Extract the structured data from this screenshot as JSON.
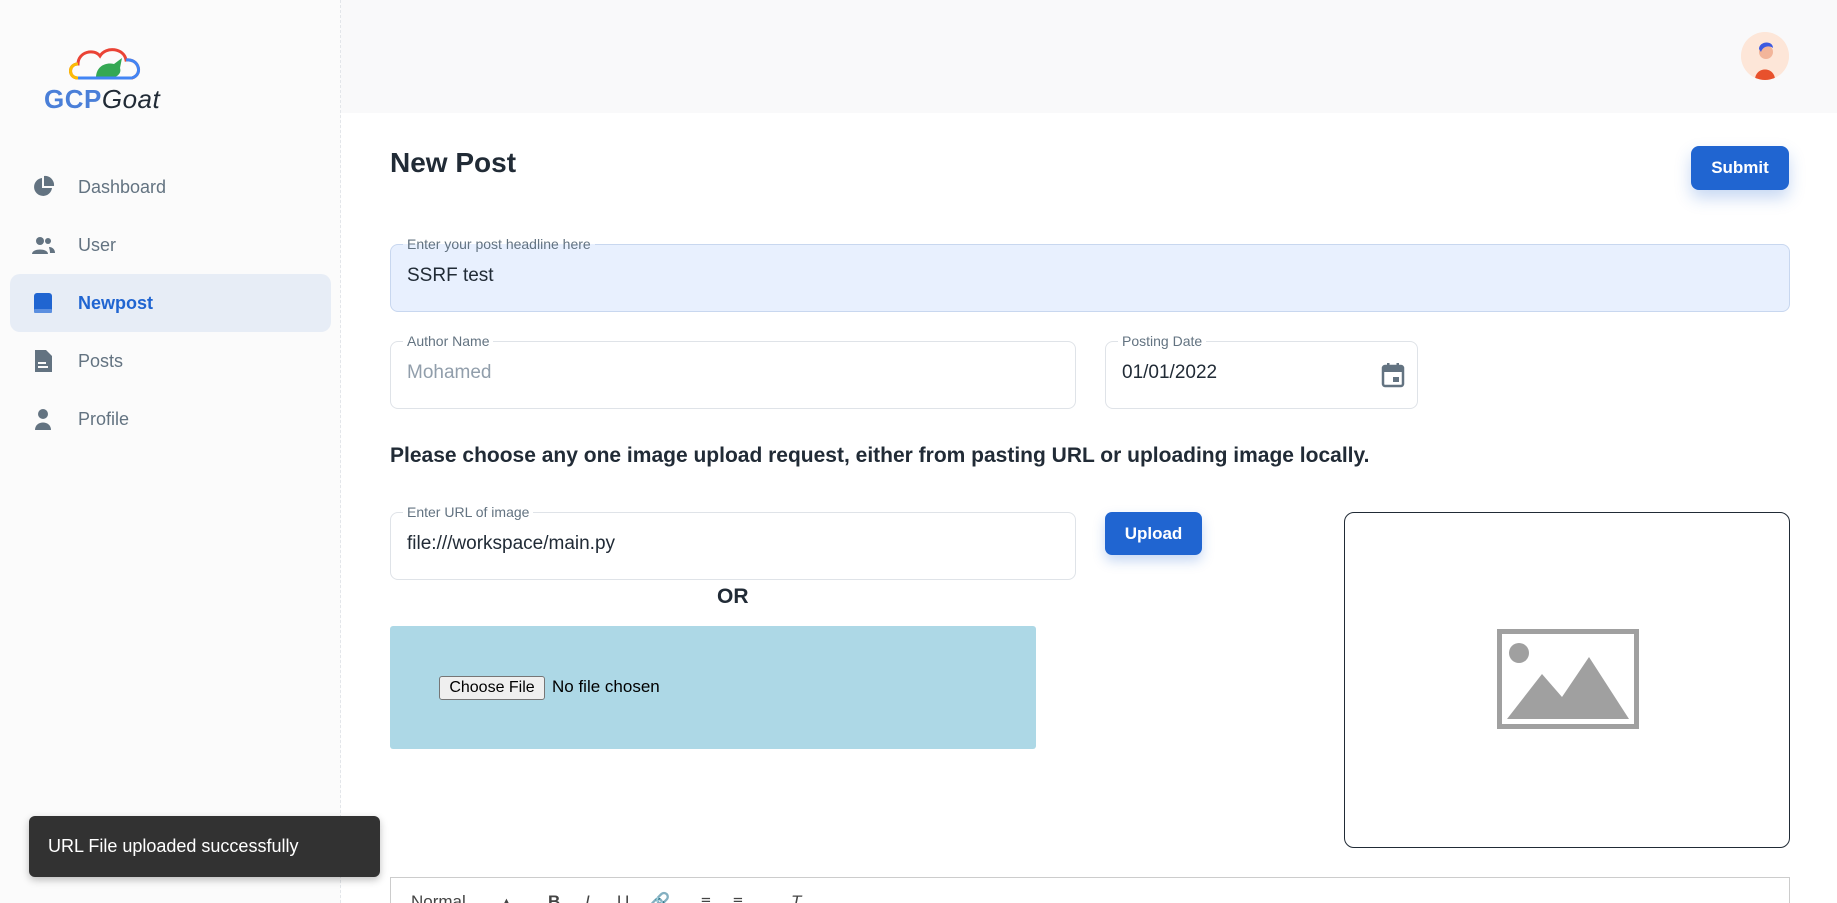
{
  "brand": {
    "logo_part1": "GCP",
    "logo_part2": "Goat"
  },
  "sidebar": {
    "items": [
      {
        "label": "Dashboard",
        "icon": "pie-chart-icon",
        "active": false
      },
      {
        "label": "User",
        "icon": "users-icon",
        "active": false
      },
      {
        "label": "Newpost",
        "icon": "book-icon",
        "active": true
      },
      {
        "label": "Posts",
        "icon": "document-icon",
        "active": false
      },
      {
        "label": "Profile",
        "icon": "person-icon",
        "active": false
      }
    ]
  },
  "header": {
    "avatar": "avatar-icon"
  },
  "page": {
    "title": "New Post",
    "submit_label": "Submit"
  },
  "form": {
    "headline": {
      "label": "Enter your post headline here",
      "value": "SSRF test"
    },
    "author": {
      "label": "Author Name",
      "value": "Mohamed"
    },
    "date": {
      "label": "Posting Date",
      "value": "01/01/2022",
      "icon": "calendar-icon"
    },
    "instruction": "Please choose any one image upload request, either from pasting URL or uploading image locally.",
    "image_url": {
      "label": "Enter URL of image",
      "value": "file:///workspace/main.py"
    },
    "upload_label": "Upload",
    "or_text": "OR",
    "file_input": {
      "button": "Choose File",
      "status": "No file chosen"
    },
    "preview_icon": "image-placeholder-icon"
  },
  "editor_toolbar": {
    "format": "Normal",
    "bold": "B",
    "italic": "I",
    "underline": "U",
    "clear": "T"
  },
  "snackbar": {
    "message": "URL File uploaded successfully"
  },
  "colors": {
    "primary": "#2065d1",
    "dropzone": "#add8e6",
    "snackbar": "#323232"
  }
}
